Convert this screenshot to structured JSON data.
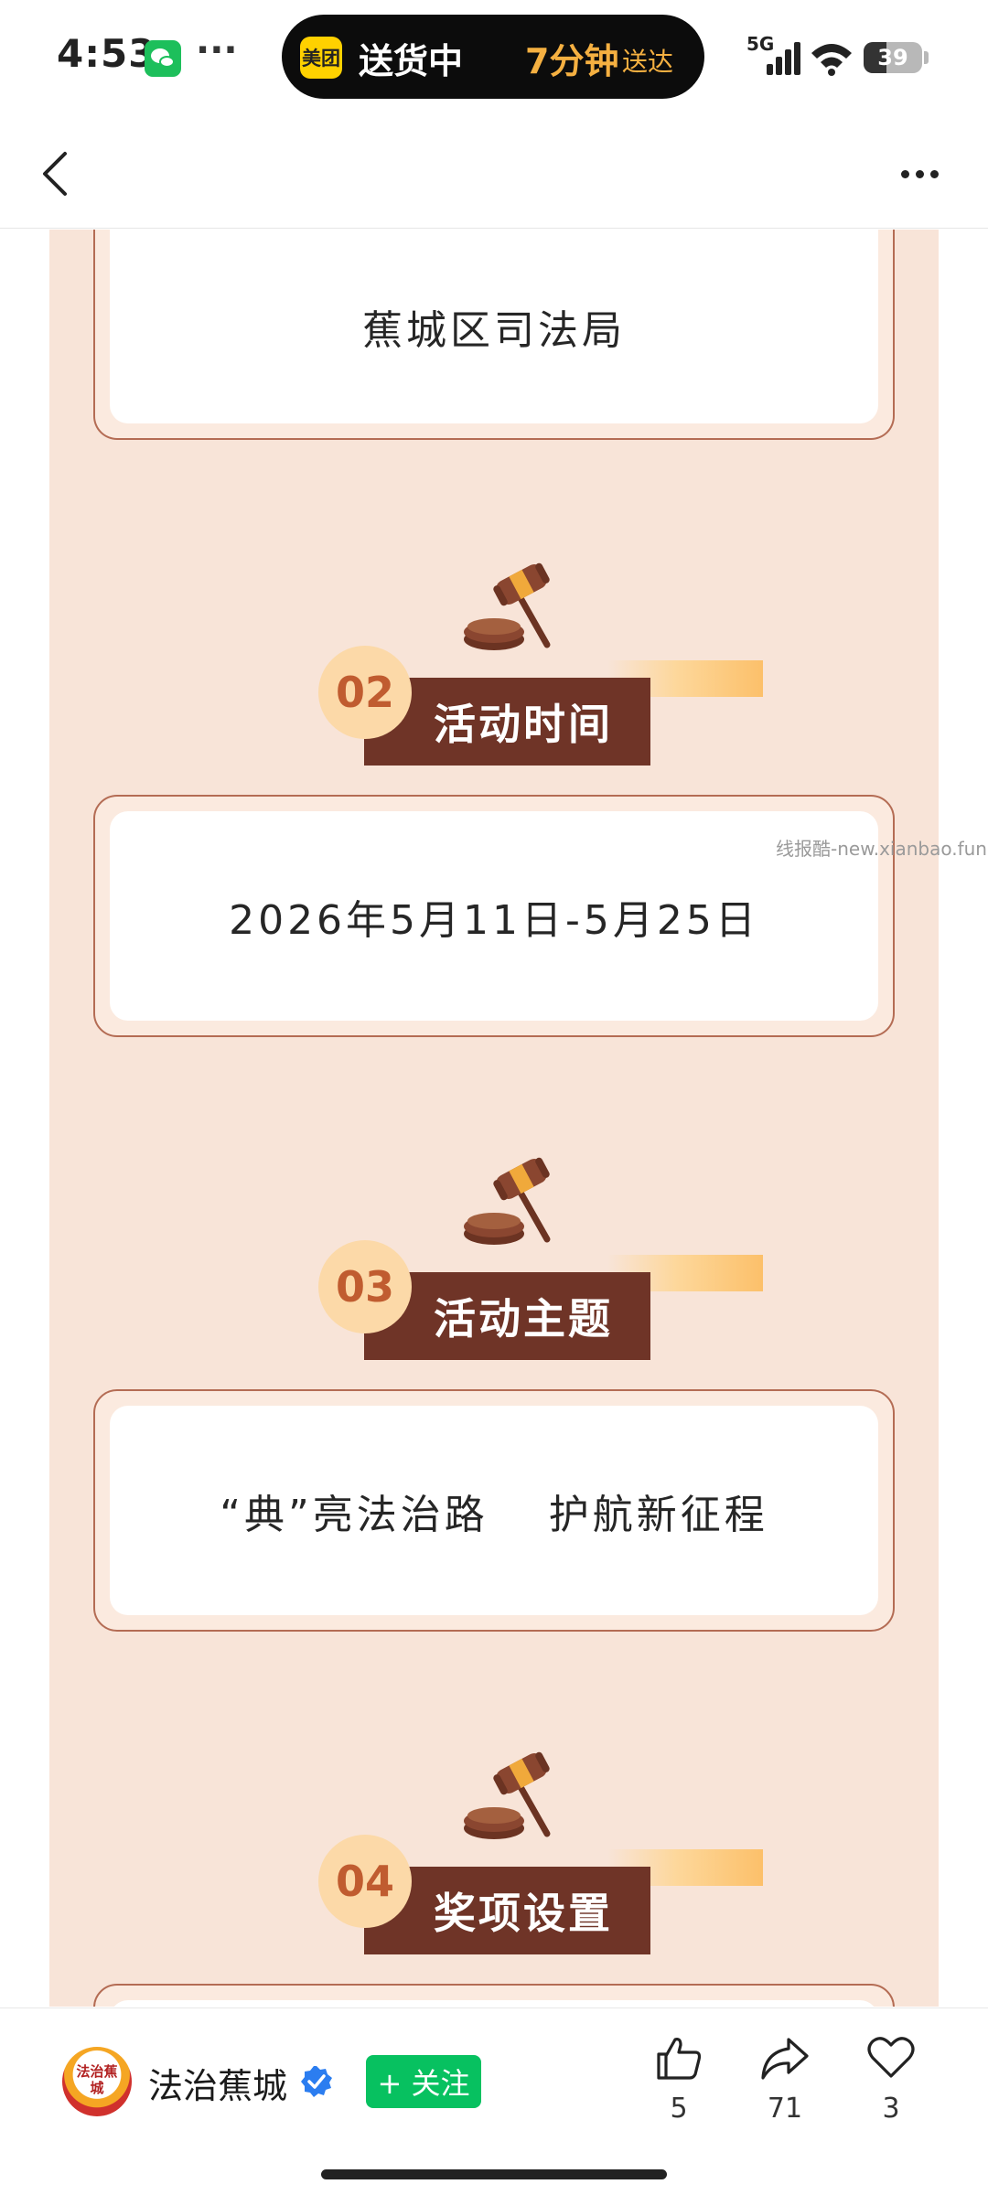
{
  "status_bar": {
    "time": "4:53",
    "app_icon": "wechat-icon",
    "more": "···",
    "live_activity": {
      "logo_text": "美团",
      "status": "送货中",
      "eta": "7分钟",
      "eta_suffix": "送达"
    },
    "network": "5G",
    "battery_level": "39",
    "battery_fraction": 0.39
  },
  "nav": {
    "back_icon": "chevron-left-icon",
    "more_icon": "more-horizontal-icon"
  },
  "article": {
    "watermark": "线报酷-new.xianbao.fun",
    "colors": {
      "poster_bg": "#f8e4d8",
      "title_box": "#6f3427",
      "number_badge": "#fcd9a8",
      "border": "#b46c54"
    },
    "top_card": {
      "text": "蕉城区司法局"
    },
    "sections": [
      {
        "number": "02",
        "title": "活动时间",
        "content": "2026年5月11日-5月25日",
        "icon": "gavel-icon"
      },
      {
        "number": "03",
        "title": "活动主题",
        "content": "“典”亮法治路　 护航新征程",
        "icon": "gavel-icon"
      },
      {
        "number": "04",
        "title": "奖项设置",
        "icon": "gavel-icon"
      }
    ]
  },
  "bottom_bar": {
    "account": {
      "avatar_text": "法治蕉城",
      "name": "法治蕉城",
      "verified_icon": "verified-badge-icon"
    },
    "follow_label": "+ 关注",
    "actions": [
      {
        "icon": "thumbs-up-icon",
        "count": "5"
      },
      {
        "icon": "share-icon",
        "count": "71"
      },
      {
        "icon": "heart-icon",
        "count": "3"
      }
    ]
  }
}
